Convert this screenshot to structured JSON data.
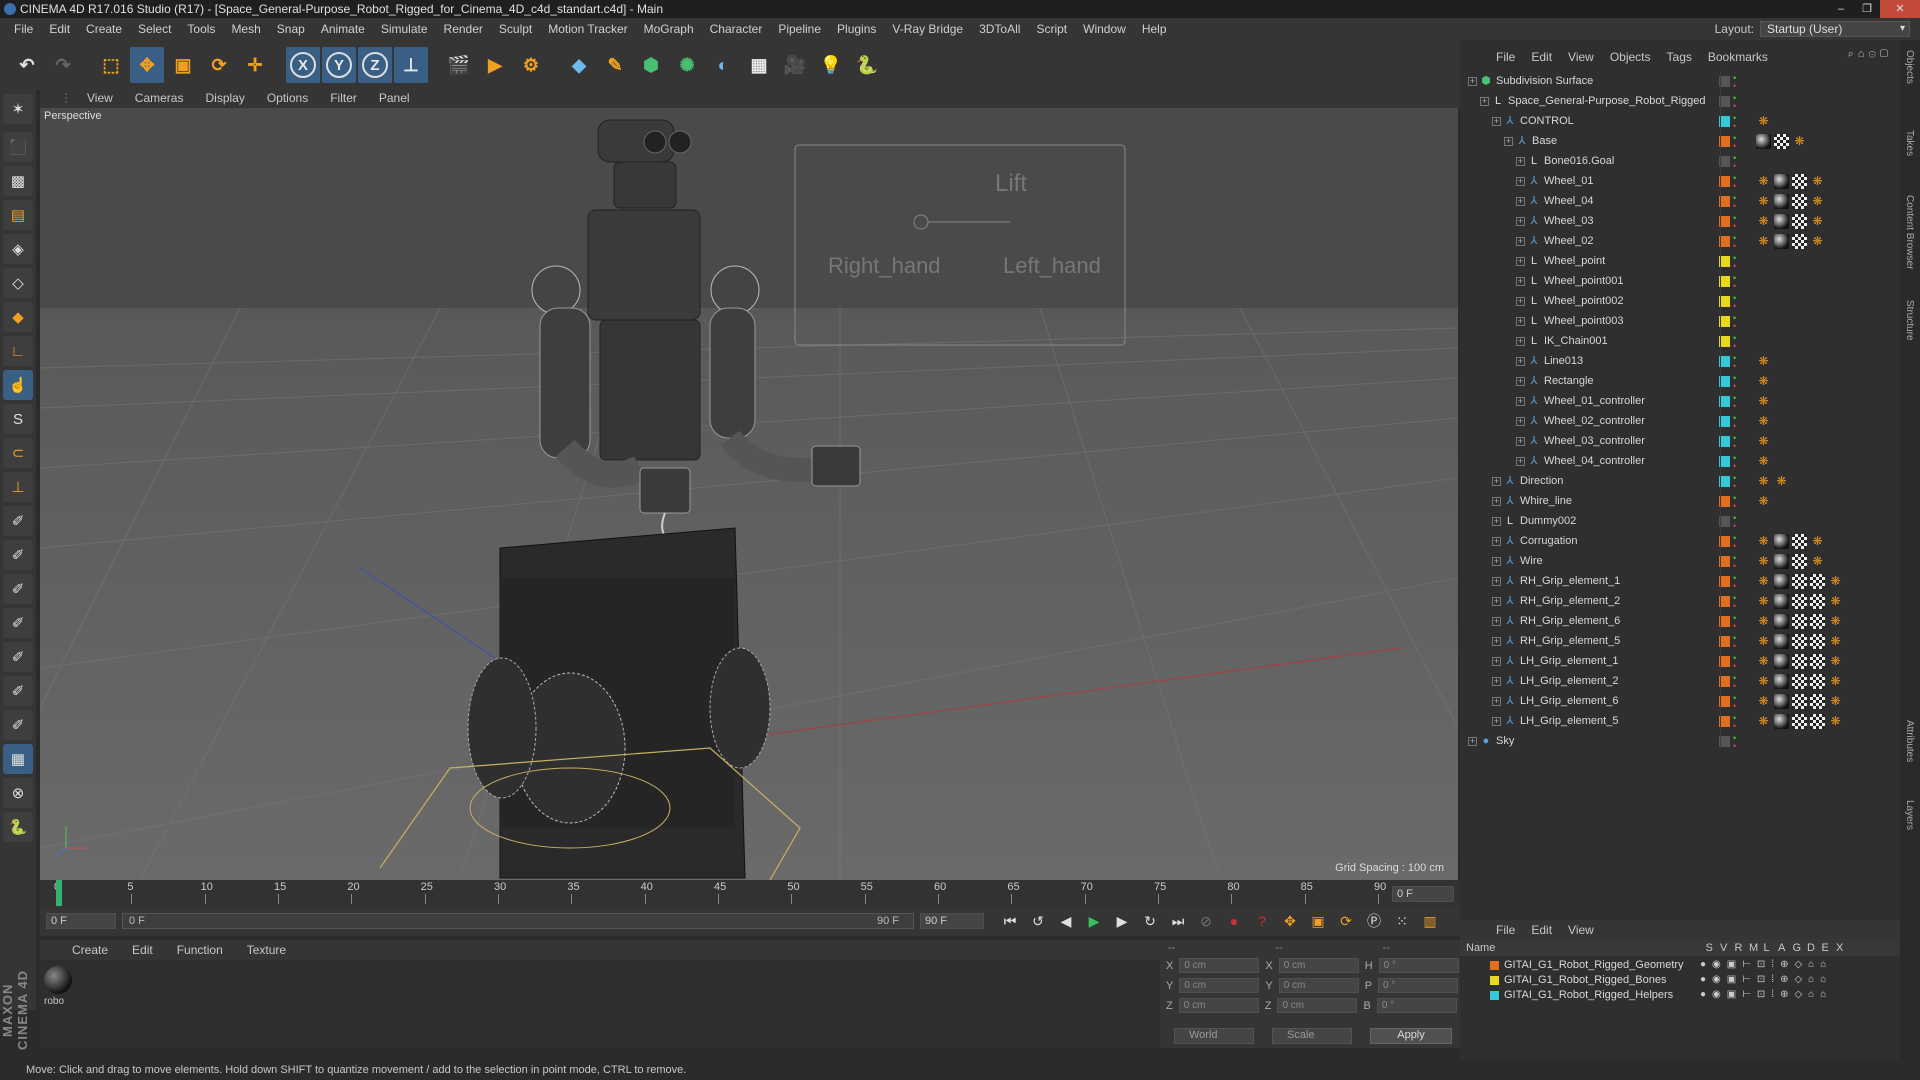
{
  "window": {
    "title": "CINEMA 4D R17.016 Studio (R17) - [Space_General-Purpose_Robot_Rigged_for_Cinema_4D_c4d_standart.c4d] - Main",
    "controls": [
      "–",
      "❐",
      "✕"
    ]
  },
  "menubar": [
    "File",
    "Edit",
    "Create",
    "Select",
    "Tools",
    "Mesh",
    "Snap",
    "Animate",
    "Simulate",
    "Render",
    "Sculpt",
    "Motion Tracker",
    "MoGraph",
    "Character",
    "Pipeline",
    "Plugins",
    "V-Ray Bridge",
    "3DToAll",
    "Script",
    "Window",
    "Help"
  ],
  "layout": {
    "label": "Layout:",
    "value": "Startup (User)"
  },
  "toolbar": {
    "icons": [
      "undo-icon",
      "redo-icon",
      "live-selection-icon",
      "move-icon",
      "scale-icon",
      "rotate-icon",
      "recent-tool-icon",
      "x-axis-icon",
      "y-axis-icon",
      "z-axis-icon",
      "world-coordinates-icon",
      "render-view-icon",
      "render-picture-viewer-icon",
      "edit-render-settings-icon",
      "cube-icon",
      "pen-icon",
      "subdivision-icon",
      "array-icon",
      "deformer-icon",
      "floor-icon",
      "camera-icon",
      "light-icon",
      "python-icon"
    ]
  },
  "viewport": {
    "menu": [
      "View",
      "Cameras",
      "Display",
      "Options",
      "Filter",
      "Panel"
    ],
    "camera_label": "Perspective",
    "grid_spacing": "Grid Spacing : 100 cm",
    "hud_labels": {
      "lift": "Lift",
      "right": "Right_hand",
      "left": "Left_hand"
    }
  },
  "timeline": {
    "ticks": [
      "0",
      "5",
      "10",
      "15",
      "20",
      "25",
      "30",
      "35",
      "40",
      "45",
      "50",
      "55",
      "60",
      "65",
      "70",
      "75",
      "80",
      "85",
      "90"
    ],
    "current_frame": "0 F",
    "start_field": "0 F",
    "range_start": "0 F",
    "range_end": "90 F",
    "end_field": "90 F"
  },
  "material_manager": {
    "menu": [
      "Create",
      "Edit",
      "Function",
      "Texture"
    ],
    "materials": [
      {
        "name": "robo"
      }
    ]
  },
  "coordinates": {
    "header": [
      "--",
      "--",
      "--"
    ],
    "rows": [
      {
        "a": "X",
        "av": "0 cm",
        "b": "X",
        "bv": "0 cm",
        "c": "H",
        "cv": "0 °"
      },
      {
        "a": "Y",
        "av": "0 cm",
        "b": "Y",
        "bv": "0 cm",
        "c": "P",
        "cv": "0 °"
      },
      {
        "a": "Z",
        "av": "0 cm",
        "b": "Z",
        "bv": "0 cm",
        "c": "B",
        "cv": "0 °"
      }
    ],
    "mode1": "World",
    "mode2": "Scale",
    "apply": "Apply"
  },
  "status": "Move: Click and drag to move elements. Hold down SHIFT to quantize movement / add to the selection in point mode, CTRL to remove.",
  "object_manager": {
    "menu": [
      "File",
      "Edit",
      "View",
      "Objects",
      "Tags",
      "Bookmarks"
    ],
    "objects": [
      {
        "name": "Subdivision Surface",
        "lvl": 0,
        "icon": "subdivision",
        "layer": "#555555",
        "tags": []
      },
      {
        "name": "Space_General-Purpose_Robot_Rigged",
        "lvl": 1,
        "icon": "null",
        "layer": "#555555",
        "tags": []
      },
      {
        "name": "CONTROL",
        "lvl": 2,
        "icon": "spline",
        "layer": "#36c8d8",
        "tags": [
          "or"
        ]
      },
      {
        "name": "Base",
        "lvl": 3,
        "icon": "spline",
        "layer": "#e07020",
        "tags": [
          "mat",
          "chk",
          "or"
        ]
      },
      {
        "name": "Bone016.Goal",
        "lvl": 4,
        "icon": "null",
        "layer": "#555555",
        "tags": []
      },
      {
        "name": "Wheel_01",
        "lvl": 4,
        "icon": "spline",
        "layer": "#e07020",
        "tags": [
          "or",
          "mat",
          "chk",
          "or"
        ]
      },
      {
        "name": "Wheel_04",
        "lvl": 4,
        "icon": "spline",
        "layer": "#e07020",
        "tags": [
          "or",
          "mat",
          "chk",
          "or"
        ]
      },
      {
        "name": "Wheel_03",
        "lvl": 4,
        "icon": "spline",
        "layer": "#e07020",
        "tags": [
          "or",
          "mat",
          "chk",
          "or"
        ]
      },
      {
        "name": "Wheel_02",
        "lvl": 4,
        "icon": "spline",
        "layer": "#e07020",
        "tags": [
          "or",
          "mat",
          "chk",
          "or"
        ]
      },
      {
        "name": "Wheel_point",
        "lvl": 4,
        "icon": "null",
        "layer": "#e8d820",
        "tags": []
      },
      {
        "name": "Wheel_point001",
        "lvl": 4,
        "icon": "null",
        "layer": "#e8d820",
        "tags": []
      },
      {
        "name": "Wheel_point002",
        "lvl": 4,
        "icon": "null",
        "layer": "#e8d820",
        "tags": []
      },
      {
        "name": "Wheel_point003",
        "lvl": 4,
        "icon": "null",
        "layer": "#e8d820",
        "tags": []
      },
      {
        "name": "IK_Chain001",
        "lvl": 4,
        "icon": "null",
        "layer": "#e8d820",
        "tags": []
      },
      {
        "name": "Line013",
        "lvl": 4,
        "icon": "spline",
        "layer": "#36c8d8",
        "tags": [
          "or"
        ]
      },
      {
        "name": "Rectangle",
        "lvl": 4,
        "icon": "spline",
        "layer": "#36c8d8",
        "tags": [
          "or"
        ]
      },
      {
        "name": "Wheel_01_controller",
        "lvl": 4,
        "icon": "spline",
        "layer": "#36c8d8",
        "tags": [
          "or"
        ]
      },
      {
        "name": "Wheel_02_controller",
        "lvl": 4,
        "icon": "spline",
        "layer": "#36c8d8",
        "tags": [
          "or"
        ]
      },
      {
        "name": "Wheel_03_controller",
        "lvl": 4,
        "icon": "spline",
        "layer": "#36c8d8",
        "tags": [
          "or"
        ]
      },
      {
        "name": "Wheel_04_controller",
        "lvl": 4,
        "icon": "spline",
        "layer": "#36c8d8",
        "tags": [
          "or"
        ]
      },
      {
        "name": "Direction",
        "lvl": 2,
        "icon": "spline",
        "layer": "#36c8d8",
        "tags": [
          "or",
          "or"
        ]
      },
      {
        "name": "Whire_line",
        "lvl": 2,
        "icon": "spline",
        "layer": "#e07020",
        "tags": [
          "or"
        ]
      },
      {
        "name": "Dummy002",
        "lvl": 2,
        "icon": "null",
        "layer": "#555555",
        "tags": []
      },
      {
        "name": "Corrugation",
        "lvl": 2,
        "icon": "spline",
        "layer": "#e07020",
        "tags": [
          "or",
          "mat",
          "chk",
          "or"
        ]
      },
      {
        "name": "Wire",
        "lvl": 2,
        "icon": "spline",
        "layer": "#e07020",
        "tags": [
          "or",
          "mat",
          "chk",
          "or"
        ]
      },
      {
        "name": "RH_Grip_element_1",
        "lvl": 2,
        "icon": "spline",
        "layer": "#e07020",
        "tags": [
          "or",
          "mat",
          "chk",
          "chk",
          "or"
        ]
      },
      {
        "name": "RH_Grip_element_2",
        "lvl": 2,
        "icon": "spline",
        "layer": "#e07020",
        "tags": [
          "or",
          "mat",
          "chk",
          "chk",
          "or"
        ]
      },
      {
        "name": "RH_Grip_element_6",
        "lvl": 2,
        "icon": "spline",
        "layer": "#e07020",
        "tags": [
          "or",
          "mat",
          "chk",
          "chk",
          "or"
        ]
      },
      {
        "name": "RH_Grip_element_5",
        "lvl": 2,
        "icon": "spline",
        "layer": "#e07020",
        "tags": [
          "or",
          "mat",
          "chk",
          "chk",
          "or"
        ]
      },
      {
        "name": "LH_Grip_element_1",
        "lvl": 2,
        "icon": "spline",
        "layer": "#e07020",
        "tags": [
          "or",
          "mat",
          "chk",
          "chk",
          "or"
        ]
      },
      {
        "name": "LH_Grip_element_2",
        "lvl": 2,
        "icon": "spline",
        "layer": "#e07020",
        "tags": [
          "or",
          "mat",
          "chk",
          "chk",
          "or"
        ]
      },
      {
        "name": "LH_Grip_element_6",
        "lvl": 2,
        "icon": "spline",
        "layer": "#e07020",
        "tags": [
          "or",
          "mat",
          "chk",
          "chk",
          "or"
        ]
      },
      {
        "name": "LH_Grip_element_5",
        "lvl": 2,
        "icon": "spline",
        "layer": "#e07020",
        "tags": [
          "or",
          "mat",
          "chk",
          "chk",
          "or"
        ]
      },
      {
        "name": "Sky",
        "lvl": 0,
        "icon": "sky",
        "layer": "#555555",
        "tags": []
      }
    ]
  },
  "layer_manager": {
    "menu": [
      "File",
      "Edit",
      "View"
    ],
    "header": [
      "Name",
      "S",
      "V",
      "R",
      "M",
      "L",
      "A",
      "G",
      "D",
      "E",
      "X"
    ],
    "layers": [
      {
        "name": "GITAI_G1_Robot_Rigged_Geometry",
        "color": "#e07020"
      },
      {
        "name": "GITAI_G1_Robot_Rigged_Bones",
        "color": "#e8d820"
      },
      {
        "name": "GITAI_G1_Robot_Rigged_Helpers",
        "color": "#36c8d8"
      }
    ]
  },
  "right_tabs": [
    "Objects",
    "Takes",
    "Content Browser",
    "Structure",
    "Attributes",
    "Layers"
  ],
  "brand": "MAXON CINEMA 4D"
}
